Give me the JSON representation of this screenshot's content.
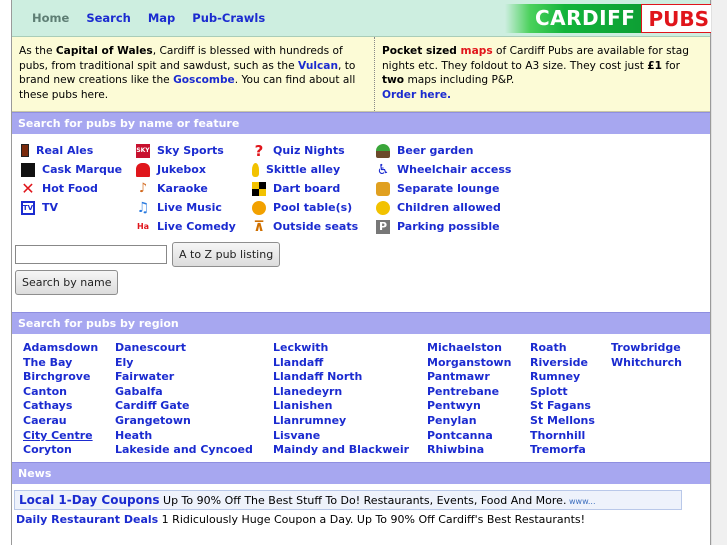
{
  "nav": {
    "home": "Home",
    "search": "Search",
    "map": "Map",
    "pubcrawls": "Pub-Crawls"
  },
  "logo": {
    "cardiff": "CARDIFF",
    "pubs": "PUBS"
  },
  "intro_left": {
    "p1": "As the ",
    "capital": "Capital of Wales",
    "p2": ", Cardiff is blessed with hundreds of pubs, from traditional spit and sawdust, such as the ",
    "vulcan": "Vulcan",
    "p3": ", to brand new creations like the ",
    "goscombe": "Goscombe",
    "p4": ". You can find about all these pubs here."
  },
  "intro_right": {
    "pocket": "Pocket sized ",
    "maps": "maps",
    "p1": " of Cardiff Pubs are available for stag nights etc. They foldout to A3 size. They cost just ",
    "price": "£1",
    "p2": " for ",
    "two": "two",
    "p3": " maps including P&P.",
    "order": "Order here."
  },
  "feature_section_title": "Search for pubs by name or feature",
  "features": [
    [
      {
        "icon": "pint-icon",
        "glyph": "",
        "label": "Real Ales"
      },
      {
        "icon": "cask-marque-icon",
        "glyph": "",
        "label": "Cask Marque"
      },
      {
        "icon": "hot-food-icon",
        "glyph": "✕",
        "label": "Hot Food"
      },
      {
        "icon": "tv-icon",
        "glyph": "TV",
        "label": "TV"
      }
    ],
    [
      {
        "icon": "sky-sports-icon",
        "glyph": "SKY",
        "label": "Sky Sports"
      },
      {
        "icon": "jukebox-icon",
        "glyph": "",
        "label": "Jukebox"
      },
      {
        "icon": "karaoke-icon",
        "glyph": "♪",
        "label": "Karaoke"
      },
      {
        "icon": "music-note-icon",
        "glyph": "♫",
        "label": "Live Music"
      },
      {
        "icon": "comedy-icon",
        "glyph": "Ha",
        "label": "Live Comedy"
      }
    ],
    [
      {
        "icon": "question-mark-icon",
        "glyph": "?",
        "label": "Quiz Nights"
      },
      {
        "icon": "skittle-icon",
        "glyph": "",
        "label": "Skittle alley"
      },
      {
        "icon": "dart-board-icon",
        "glyph": "",
        "label": "Dart board"
      },
      {
        "icon": "pool-ball-icon",
        "glyph": "",
        "label": "Pool table(s)"
      },
      {
        "icon": "outside-seats-icon",
        "glyph": "⊼",
        "label": "Outside seats"
      }
    ],
    [
      {
        "icon": "beer-garden-icon",
        "glyph": "",
        "label": "Beer garden"
      },
      {
        "icon": "wheelchair-icon",
        "glyph": "♿",
        "label": "Wheelchair access"
      },
      {
        "icon": "lounge-icon",
        "glyph": "",
        "label": "Separate lounge"
      },
      {
        "icon": "children-icon",
        "glyph": "",
        "label": "Children allowed"
      },
      {
        "icon": "parking-icon",
        "glyph": "P",
        "label": "Parking possible"
      }
    ]
  ],
  "search": {
    "a_to_z_label": "A to Z pub listing",
    "by_name_label": "Search by name",
    "input_value": ""
  },
  "region_section_title": "Search for pubs by region",
  "regions": [
    [
      "Adamsdown",
      "The Bay",
      "Birchgrove",
      "Canton",
      "Cathays",
      "Caerau",
      "City Centre",
      "Coryton"
    ],
    [
      "Danescourt",
      "Ely",
      "Fairwater",
      "Gabalfa",
      "Cardiff Gate",
      "Grangetown",
      "Heath",
      "Lakeside and Cyncoed"
    ],
    [
      "Leckwith",
      "Llandaff",
      "Llandaff North",
      "Llanedeyrn",
      "Llanishen",
      "Llanrumney",
      "Lisvane",
      "Maindy and Blackweir"
    ],
    [
      "Michaelston",
      "Morganstown",
      "Pantmawr",
      "Pentrebane",
      "Pentwyn",
      "Penylan",
      "Pontcanna",
      "Rhiwbina"
    ],
    [
      "Roath",
      "Riverside",
      "Rumney",
      "Splott",
      "St Fagans",
      "St Mellons",
      "Thornhill",
      "Tremorfa"
    ],
    [
      "Trowbridge",
      "Whitchurch"
    ]
  ],
  "news_section_title": "News",
  "ads": {
    "ad1_title": "Local 1-Day Coupons",
    "ad1_text": " Up To 90% Off The Best Stuff To Do! Restaurants, Events, Food And More.",
    "ad1_url": " www...",
    "ad2_title": "Daily Restaurant Deals",
    "ad2_text": " 1 Ridiculously Huge Coupon a Day. Up To 90% Off Cardiff's Best Restaurants!"
  }
}
